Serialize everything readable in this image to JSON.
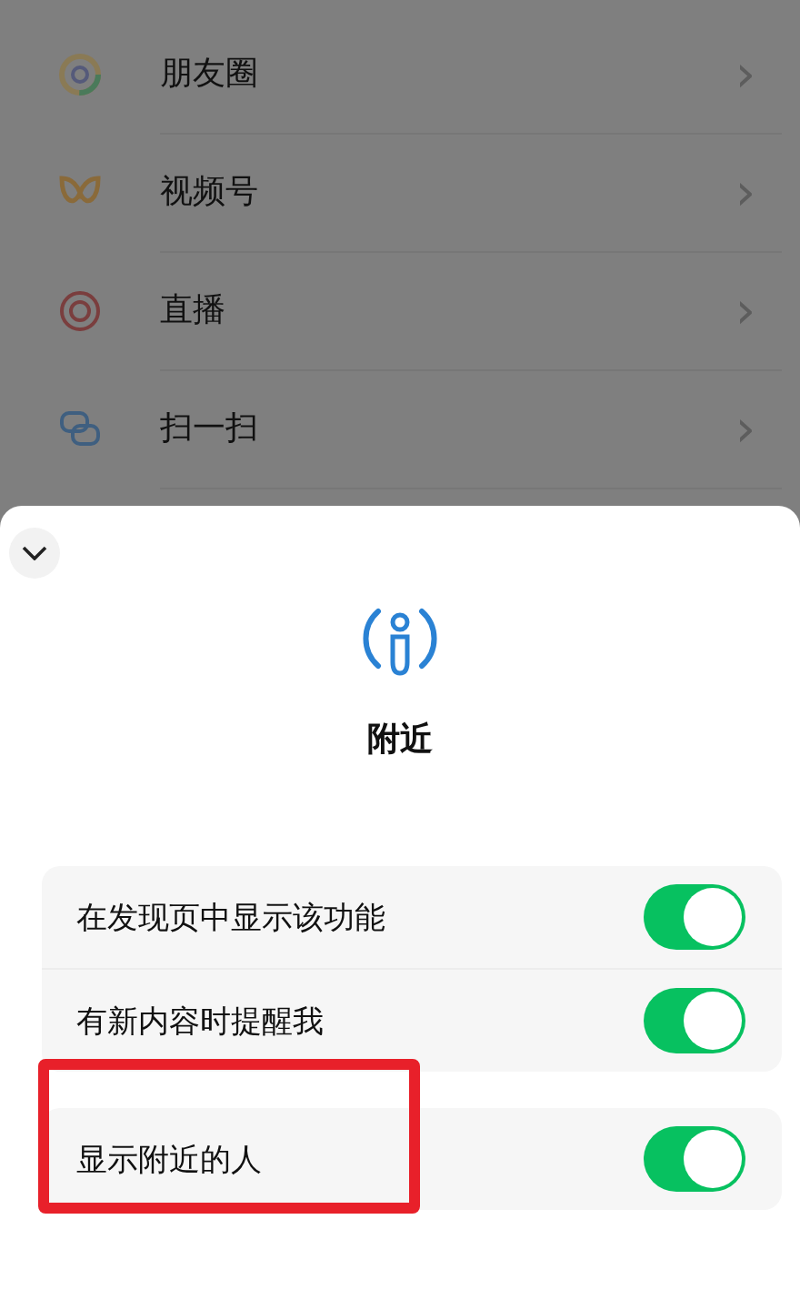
{
  "discover_menu": [
    {
      "label": "朋友圈",
      "chevron": "›"
    },
    {
      "label": "视频号",
      "chevron": "›"
    },
    {
      "label": "直播",
      "chevron": "›"
    },
    {
      "label": "扫一扫",
      "chevron": "›"
    }
  ],
  "sheet": {
    "title": "附近",
    "settings_groups": [
      [
        {
          "label": "在发现页中显示该功能",
          "on": true,
          "highlighted": false
        },
        {
          "label": "有新内容时提醒我",
          "on": true,
          "highlighted": false
        }
      ],
      [
        {
          "label": "显示附近的人",
          "on": true,
          "highlighted": true
        }
      ]
    ]
  }
}
